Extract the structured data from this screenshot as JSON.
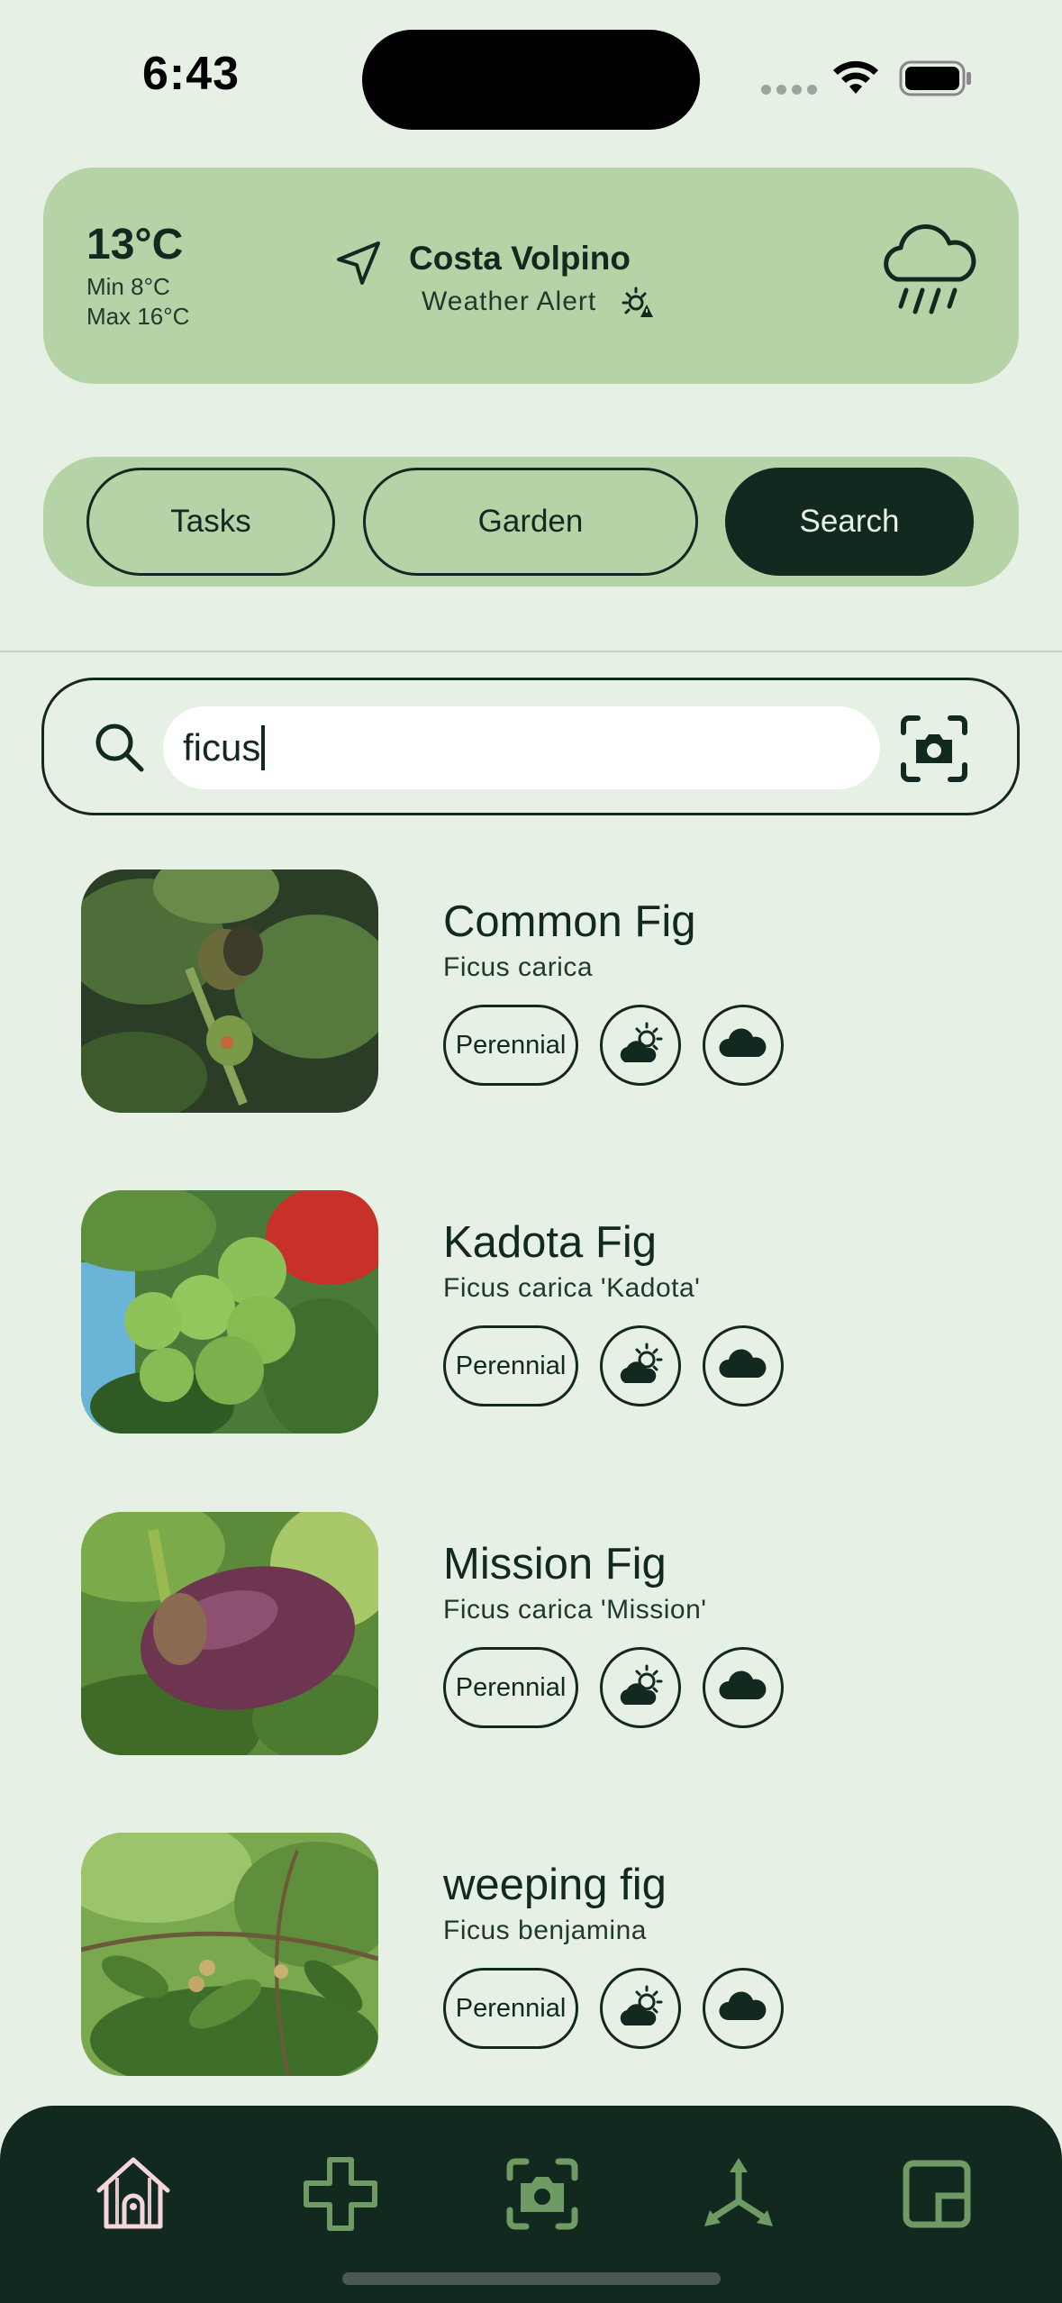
{
  "status_bar": {
    "time": "6:43"
  },
  "weather": {
    "temperature": "13°C",
    "min": "Min 8°C",
    "max": "Max 16°C",
    "location": "Costa Volpino",
    "alert": "Weather Alert",
    "condition_icon": "rain-cloud-icon"
  },
  "segments": {
    "tasks": "Tasks",
    "garden": "Garden",
    "search": "Search",
    "selected": "Search"
  },
  "search": {
    "value": "ficus"
  },
  "results": [
    {
      "name": "Common Fig",
      "scientific": "Ficus carica",
      "lifecycle": "Perennial",
      "light_icon": "partial-sun-icon",
      "climate_icon": "cloud-icon"
    },
    {
      "name": "Kadota Fig",
      "scientific": "Ficus carica 'Kadota'",
      "lifecycle": "Perennial",
      "light_icon": "partial-sun-icon",
      "climate_icon": "cloud-icon"
    },
    {
      "name": "Mission Fig",
      "scientific": "Ficus carica 'Mission'",
      "lifecycle": "Perennial",
      "light_icon": "partial-sun-icon",
      "climate_icon": "cloud-icon"
    },
    {
      "name": "weeping fig",
      "scientific": "Ficus benjamina",
      "lifecycle": "Perennial",
      "light_icon": "partial-sun-icon",
      "climate_icon": "cloud-icon"
    }
  ],
  "tab_bar": {
    "items": [
      "home-icon",
      "plus-icon",
      "camera-icon",
      "share-icon",
      "layout-icon"
    ],
    "active": "home-icon"
  },
  "colors": {
    "background": "#e7f0e4",
    "card": "#b4d3a7",
    "dark": "#12291f",
    "active_tab_icon": "#f4d6dc",
    "inactive_tab_icon": "#6e9a63"
  }
}
